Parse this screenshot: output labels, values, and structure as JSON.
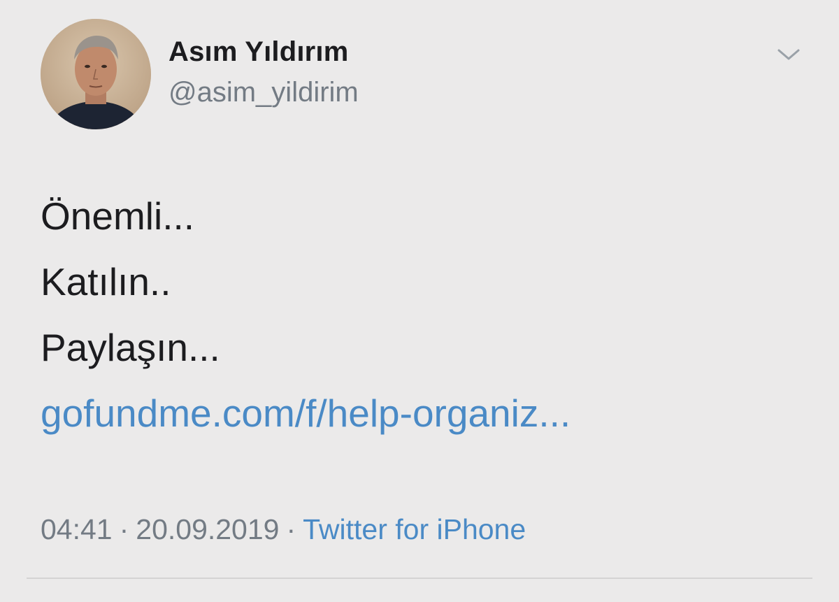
{
  "tweet": {
    "display_name": "Asım Yıldırım",
    "handle": "@asim_yildirim",
    "body_lines": [
      "Önemli...",
      "Katılın..",
      "Paylaşın..."
    ],
    "link_text": "gofundme.com/f/help-organiz...",
    "time": "04:41",
    "separator": "·",
    "date": "20.09.2019",
    "source": "Twitter for iPhone"
  },
  "icons": {
    "menu": "chevron-down-icon"
  },
  "colors": {
    "background": "#ebeaea",
    "link": "#4a8ac6",
    "secondary_text": "#737b84"
  }
}
